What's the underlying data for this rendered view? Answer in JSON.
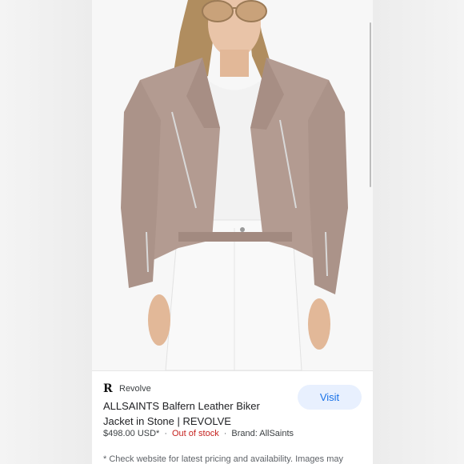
{
  "product": {
    "image_alt": "Model wearing stone leather biker jacket, white tank top and white jeans",
    "source_name": "Revolve",
    "source_logo": "R",
    "title": "ALLSAINTS Balfern Leather Biker Jacket in Stone | REVOLVE",
    "price": "$498.00 USD*",
    "stock_status": "Out of stock",
    "brand": "Brand: AllSaints",
    "visit_label": "Visit",
    "footnote": "* Check website for latest pricing and availability. Images may"
  },
  "colors": {
    "jacket": "#b39b91",
    "accent": "#1a73e8",
    "stock_red": "#c5221f"
  }
}
